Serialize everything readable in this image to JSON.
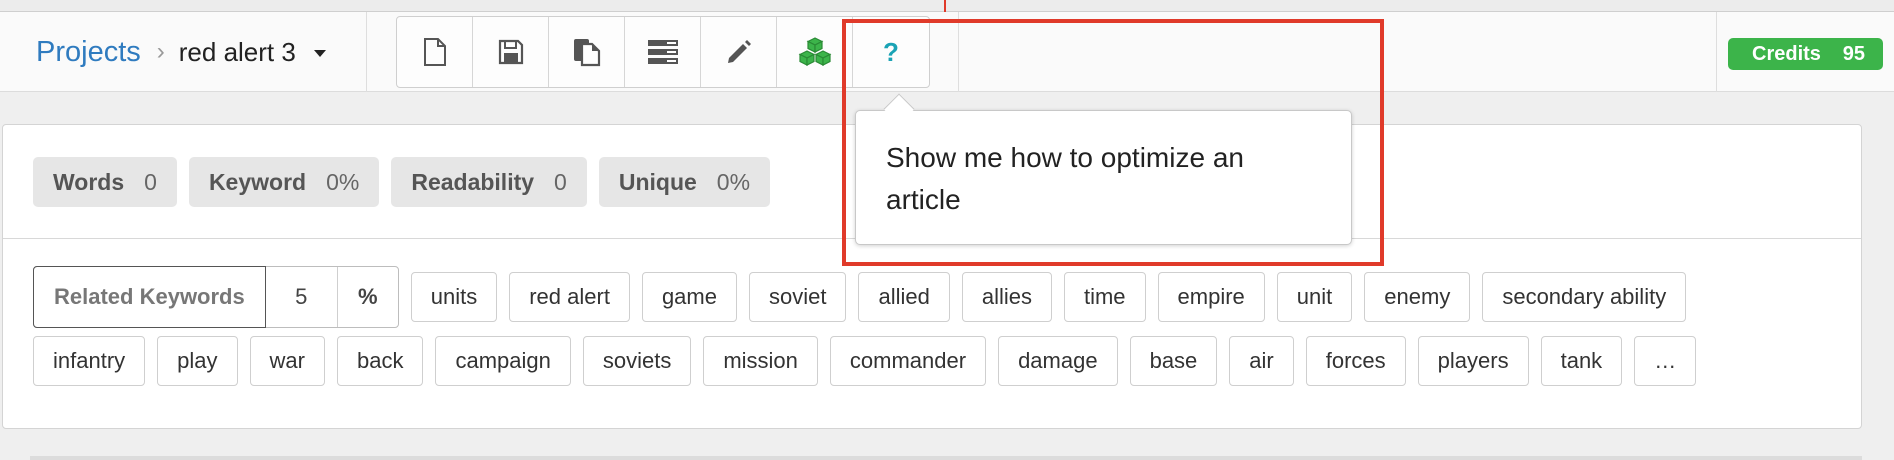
{
  "header": {
    "breadcrumb": {
      "projects_label": "Projects",
      "separator": "›",
      "project_name": "red alert 3"
    },
    "toolbar": {
      "buttons": [
        {
          "icon": "new-document-icon"
        },
        {
          "icon": "save-icon"
        },
        {
          "icon": "copy-icon"
        },
        {
          "icon": "outline-list-icon"
        },
        {
          "icon": "pencil-icon"
        },
        {
          "icon": "cubes-icon",
          "color": "#3cb44a"
        },
        {
          "icon": "help-icon",
          "label": "?",
          "color": "#1aa3b5"
        }
      ]
    },
    "credits": {
      "label": "Credits",
      "value": "95",
      "color": "#3cb44a"
    }
  },
  "stats": [
    {
      "label": "Words",
      "value": "0"
    },
    {
      "label": "Keyword",
      "value": "0%"
    },
    {
      "label": "Readability",
      "value": "0"
    },
    {
      "label": "Unique",
      "value": "0%"
    }
  ],
  "related_keywords": {
    "label": "Related Keywords",
    "count": "5",
    "unit": "%",
    "row1": [
      "units",
      "red alert",
      "game",
      "soviet",
      "allied",
      "allies",
      "time",
      "empire",
      "unit",
      "enemy",
      "secondary ability"
    ],
    "row2": [
      "infantry",
      "play",
      "war",
      "back",
      "campaign",
      "soviets",
      "mission",
      "commander",
      "damage",
      "base",
      "air",
      "forces",
      "players",
      "tank",
      "…"
    ]
  },
  "tooltip": {
    "text": "Show me how to optimize an article"
  },
  "colors": {
    "highlight": "#e03a2a",
    "link": "#2f7bbf"
  }
}
